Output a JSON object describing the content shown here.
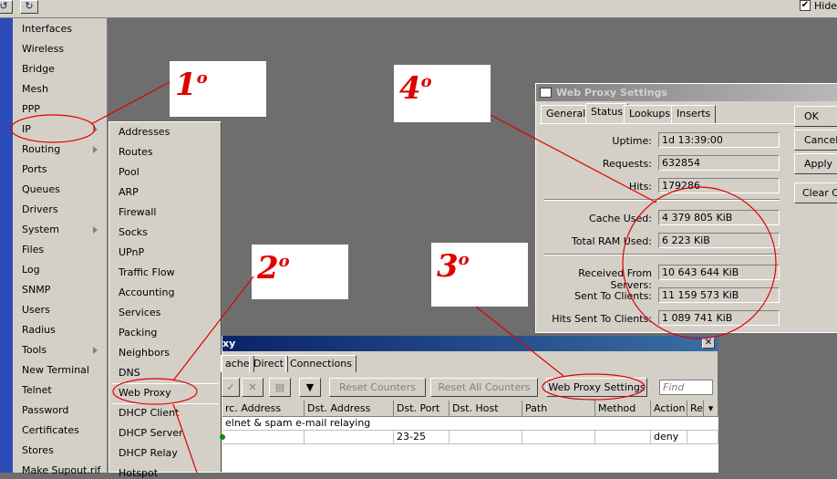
{
  "topbar": {
    "undo_glyph": "↺",
    "redo_glyph": "↻",
    "hide_label": "Hide",
    "hide_checked": "✔"
  },
  "sidebar": {
    "items": [
      {
        "label": "Interfaces"
      },
      {
        "label": "Wireless"
      },
      {
        "label": "Bridge"
      },
      {
        "label": "Mesh"
      },
      {
        "label": "PPP"
      },
      {
        "label": "IP"
      },
      {
        "label": "Routing"
      },
      {
        "label": "Ports"
      },
      {
        "label": "Queues"
      },
      {
        "label": "Drivers"
      },
      {
        "label": "System"
      },
      {
        "label": "Files"
      },
      {
        "label": "Log"
      },
      {
        "label": "SNMP"
      },
      {
        "label": "Users"
      },
      {
        "label": "Radius"
      },
      {
        "label": "Tools"
      },
      {
        "label": "New Terminal"
      },
      {
        "label": "Telnet"
      },
      {
        "label": "Password"
      },
      {
        "label": "Certificates"
      },
      {
        "label": "Stores"
      },
      {
        "label": "Make Supout.rif"
      }
    ]
  },
  "ip_menu": {
    "items": [
      {
        "label": "Addresses"
      },
      {
        "label": "Routes"
      },
      {
        "label": "Pool"
      },
      {
        "label": "ARP"
      },
      {
        "label": "Firewall"
      },
      {
        "label": "Socks"
      },
      {
        "label": "UPnP"
      },
      {
        "label": "Traffic Flow"
      },
      {
        "label": "Accounting"
      },
      {
        "label": "Services"
      },
      {
        "label": "Packing"
      },
      {
        "label": "Neighbors"
      },
      {
        "label": "DNS"
      },
      {
        "label": "Web Proxy"
      },
      {
        "label": "DHCP Client"
      },
      {
        "label": "DHCP Server"
      },
      {
        "label": "DHCP Relay"
      },
      {
        "label": "Hotspot"
      }
    ]
  },
  "annotations": {
    "n1": "1",
    "n2": "2",
    "n3": "3",
    "n4": "4",
    "deg": "o",
    "color": "#e00000"
  },
  "web_proxy_settings": {
    "title": "Web Proxy Settings",
    "tabs": [
      {
        "label": "General"
      },
      {
        "label": "Status"
      },
      {
        "label": "Lookups"
      },
      {
        "label": "Inserts"
      }
    ],
    "fields": {
      "uptime": {
        "label": "Uptime:",
        "value": "1d 13:39:00"
      },
      "requests": {
        "label": "Requests:",
        "value": "632854"
      },
      "hits": {
        "label": "Hits:",
        "value": "179286"
      },
      "cache_used": {
        "label": "Cache Used:",
        "value": "4 379 805 KiB"
      },
      "total_ram": {
        "label": "Total RAM Used:",
        "value": "6 223 KiB"
      },
      "received": {
        "label": "Received From Servers:",
        "value": "10 643 644 KiB"
      },
      "sent": {
        "label": "Sent To Clients:",
        "value": "11 159 573 KiB"
      },
      "hits_sent": {
        "label": "Hits Sent To Clients:",
        "value": "1 089 741 KiB"
      }
    },
    "buttons": {
      "ok": "OK",
      "cancel": "Cancel",
      "apply": "Apply",
      "clear": "Clear Cache"
    }
  },
  "proxy_window": {
    "title": "xy",
    "close": "✕",
    "tabs": [
      {
        "label": "ache"
      },
      {
        "label": "Direct"
      },
      {
        "label": "Connections"
      }
    ],
    "toolbar": {
      "check": "✓",
      "remove": "✕",
      "copy": "▤",
      "filter": "▼",
      "reset_counters": "Reset Counters",
      "reset_all": "Reset All Counters",
      "settings": "Web Proxy Settings",
      "find_placeholder": "Find"
    },
    "columns": [
      "rc. Address",
      "Dst. Address",
      "Dst. Port",
      "Dst. Host",
      "Path",
      "Method",
      "Action",
      "Re"
    ],
    "comment": "elnet & spam e-mail relaying",
    "row": {
      "src": "",
      "dst": "",
      "port": "23-25",
      "host": "",
      "path": "",
      "method": "",
      "action": "deny",
      "re": ""
    }
  }
}
